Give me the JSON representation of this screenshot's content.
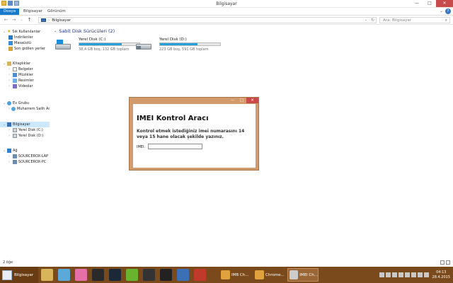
{
  "window": {
    "title": "Bilgisayar",
    "minimize_glyph": "—",
    "maximize_glyph": "□",
    "close_glyph": "✕"
  },
  "ribbon": {
    "tabs": [
      "Dosya",
      "Bilgisayar",
      "Görünüm"
    ],
    "help_glyph": "?",
    "expand_glyph": "⌄"
  },
  "address": {
    "back_glyph": "←",
    "forward_glyph": "→",
    "recent_glyph": "⌄",
    "up_glyph": "↑",
    "separator": "›",
    "path": "Bilgisayar",
    "dropdown_glyph": "⌄",
    "refresh_glyph": "↻",
    "search_placeholder": "Ara: Bilgisayar",
    "search_icon": "search-icon",
    "search_glyph": "⌕"
  },
  "nav": {
    "favorites": {
      "label": "Sık Kullanılanlar",
      "items": [
        "İndirilenler",
        "Masaüstü",
        "Son gidilen yerler"
      ]
    },
    "libraries": {
      "label": "Kitaplıklar",
      "items": [
        "Belgeler",
        "Müzikler",
        "Resimler",
        "Videolar"
      ]
    },
    "homegroup": {
      "label": "Ev Grubu",
      "items": [
        "Muharrem Salih Ard"
      ]
    },
    "computer": {
      "label": "Bilgisayar",
      "items": [
        "Yerel Disk (C:)",
        "Yerel Disk (D:)"
      ]
    },
    "network": {
      "label": "Ağ",
      "items": [
        "SOURCEROX-LAP",
        "SOURCEROX-PC"
      ]
    }
  },
  "content": {
    "group_label": "Sabit Disk Sürücüleri (2)",
    "drives": [
      {
        "name": "Yerel Disk (C:)",
        "info": "38,4 GB boş, 132 GB toplam",
        "used_fraction": 0.71
      },
      {
        "name": "Yerel Disk (D:)",
        "info": "223 GB boş, 591 GB toplam",
        "used_fraction": 0.62
      }
    ]
  },
  "statusbar": {
    "count": "2 öğe"
  },
  "dialog": {
    "minimize_glyph": "—",
    "maximize_glyph": "□",
    "close_glyph": "✕",
    "heading": "IMEI Kontrol Aracı",
    "instruction": "Kontrol etmek istediğiniz imei numarasını 14 veya 15 hane olacak şekilde yazınız.",
    "field_label": "IMEI:",
    "field_value": ""
  },
  "taskbar": {
    "start_label": "Bilgisayar",
    "pinned": [
      {
        "name": "explorer",
        "color": "#d8b45a"
      },
      {
        "name": "paint",
        "color": "#5aa9d8"
      },
      {
        "name": "pink-app",
        "color": "#e76fa7"
      },
      {
        "name": "league",
        "color": "#2a2a2a"
      },
      {
        "name": "steam",
        "color": "#1b2838"
      },
      {
        "name": "utorrent",
        "color": "#6ab32e"
      },
      {
        "name": "app-g",
        "color": "#333333"
      },
      {
        "name": "app-h",
        "color": "#222222"
      },
      {
        "name": "app-d",
        "color": "#3b6fb6"
      },
      {
        "name": "app-x",
        "color": "#c0392b"
      }
    ],
    "windows": [
      {
        "label": "IMB Ch...",
        "color": "#e0a23c"
      },
      {
        "label": "Chrome...",
        "color": "#e0a23c"
      },
      {
        "label": "IMEI Ch...",
        "color": "#cccccc"
      }
    ],
    "tray_icons": 8,
    "time": "04:13",
    "date": "28.4.2015"
  }
}
